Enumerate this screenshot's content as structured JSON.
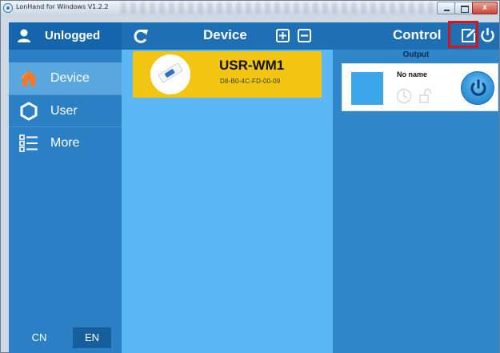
{
  "window": {
    "title": "LonHand for Windows V1.2.2",
    "close_glyph": "x"
  },
  "sidebar": {
    "user_label": "Unlogged",
    "items": [
      {
        "label": "Device",
        "icon": "home-icon",
        "active": true
      },
      {
        "label": "User",
        "icon": "hexagon-icon",
        "active": false
      },
      {
        "label": "More",
        "icon": "list-icon",
        "active": false
      }
    ],
    "languages": [
      "CN",
      "EN"
    ],
    "selected_language": "EN"
  },
  "device_panel": {
    "title": "Device",
    "devices": [
      {
        "name": "USR-WM1",
        "mac": "D8-B0-4C-FD-00-09"
      }
    ]
  },
  "control_panel": {
    "title": "Control",
    "subtitle": "Output",
    "outputs": [
      {
        "name": "No name"
      }
    ]
  },
  "colors": {
    "accent_yellow": "#f2c513",
    "highlight_red": "#d6141c",
    "sidebar_blue": "#2b7fc4",
    "device_bg": "#5bb8f4"
  }
}
